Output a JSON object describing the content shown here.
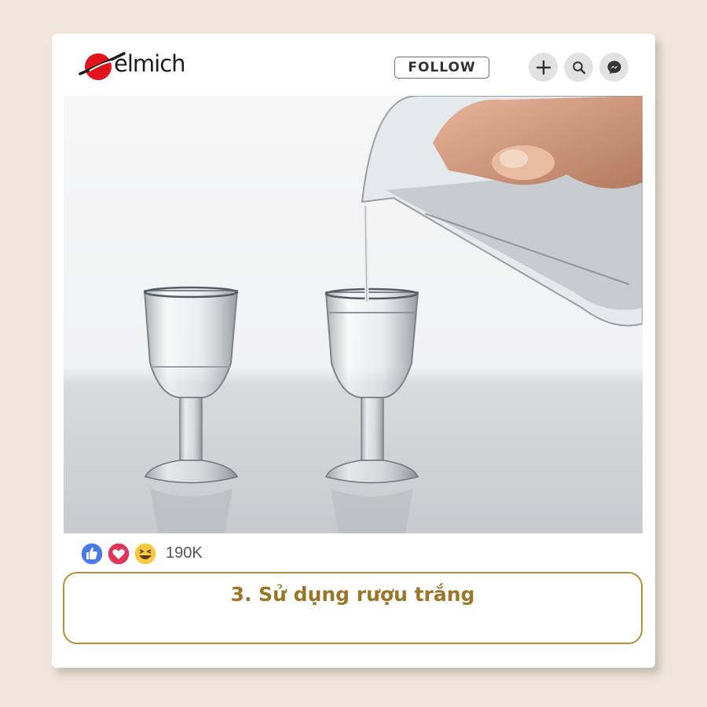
{
  "brand": {
    "name": "elmich",
    "logo_icon": "elmich-logo-icon",
    "accent": "#e1141c"
  },
  "header": {
    "follow_label": "FOLLOW",
    "actions": [
      {
        "icon": "plus-icon"
      },
      {
        "icon": "search-icon"
      },
      {
        "icon": "messenger-icon"
      }
    ]
  },
  "post": {
    "image": "two stemmed shot glasses with clear liquid being poured from a glass pitcher",
    "reactions": {
      "icons": [
        "like-icon",
        "love-icon",
        "haha-icon"
      ],
      "count": "190K"
    },
    "caption": "3. Sử dụng rượu trắng",
    "caption_color": "#9a7628"
  }
}
